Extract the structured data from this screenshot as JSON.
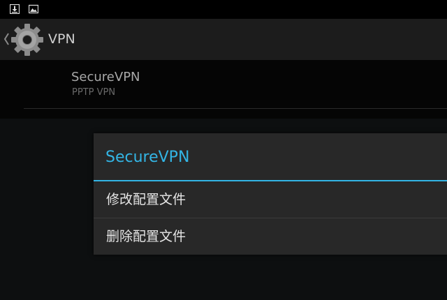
{
  "status_bar": {
    "icons": [
      "download-icon",
      "image-icon"
    ]
  },
  "action_bar": {
    "title": "VPN",
    "icon": "settings-gear-icon"
  },
  "vpn_list": {
    "items": [
      {
        "name": "SecureVPN",
        "type": "PPTP VPN"
      }
    ]
  },
  "dialog": {
    "title": "SecureVPN",
    "options": [
      {
        "label": "修改配置文件"
      },
      {
        "label": "删除配置文件"
      }
    ]
  },
  "colors": {
    "accent": "#33b5e5",
    "dialog_background": "#282828",
    "action_bar_background": "#1c1c1c"
  }
}
